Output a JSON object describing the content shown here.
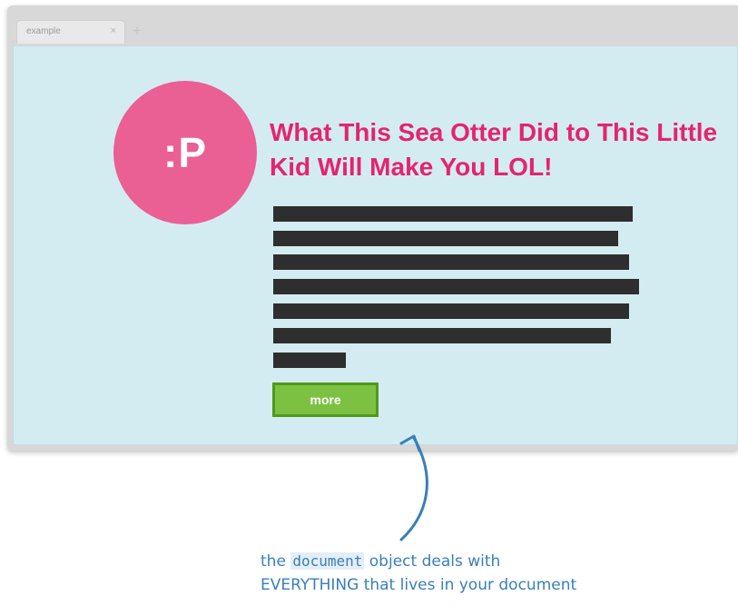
{
  "browser": {
    "tab_label": "example",
    "tab_close_glyph": "×",
    "new_tab_glyph": "+"
  },
  "page": {
    "avatar_text": ":P",
    "headline": "What This Sea Otter Did to This Little Kid Will Make You LOL!",
    "redacted_line_count": 7,
    "more_button_label": "more"
  },
  "annotation": {
    "before_code": "the ",
    "code": "document",
    "after_code": " object deals with",
    "line2": "EVERYTHING that lives in your document"
  },
  "colors": {
    "viewport_bg": "#d3ecf2",
    "avatar": "#ea5f94",
    "headline": "#e4246e",
    "redaction_bar": "#2e2e2e",
    "button_fill": "#7dc142",
    "button_border": "#4f9a1e",
    "annotation": "#3a7fb8"
  },
  "icons": {
    "arrow": "curved-up-arrow-icon"
  }
}
